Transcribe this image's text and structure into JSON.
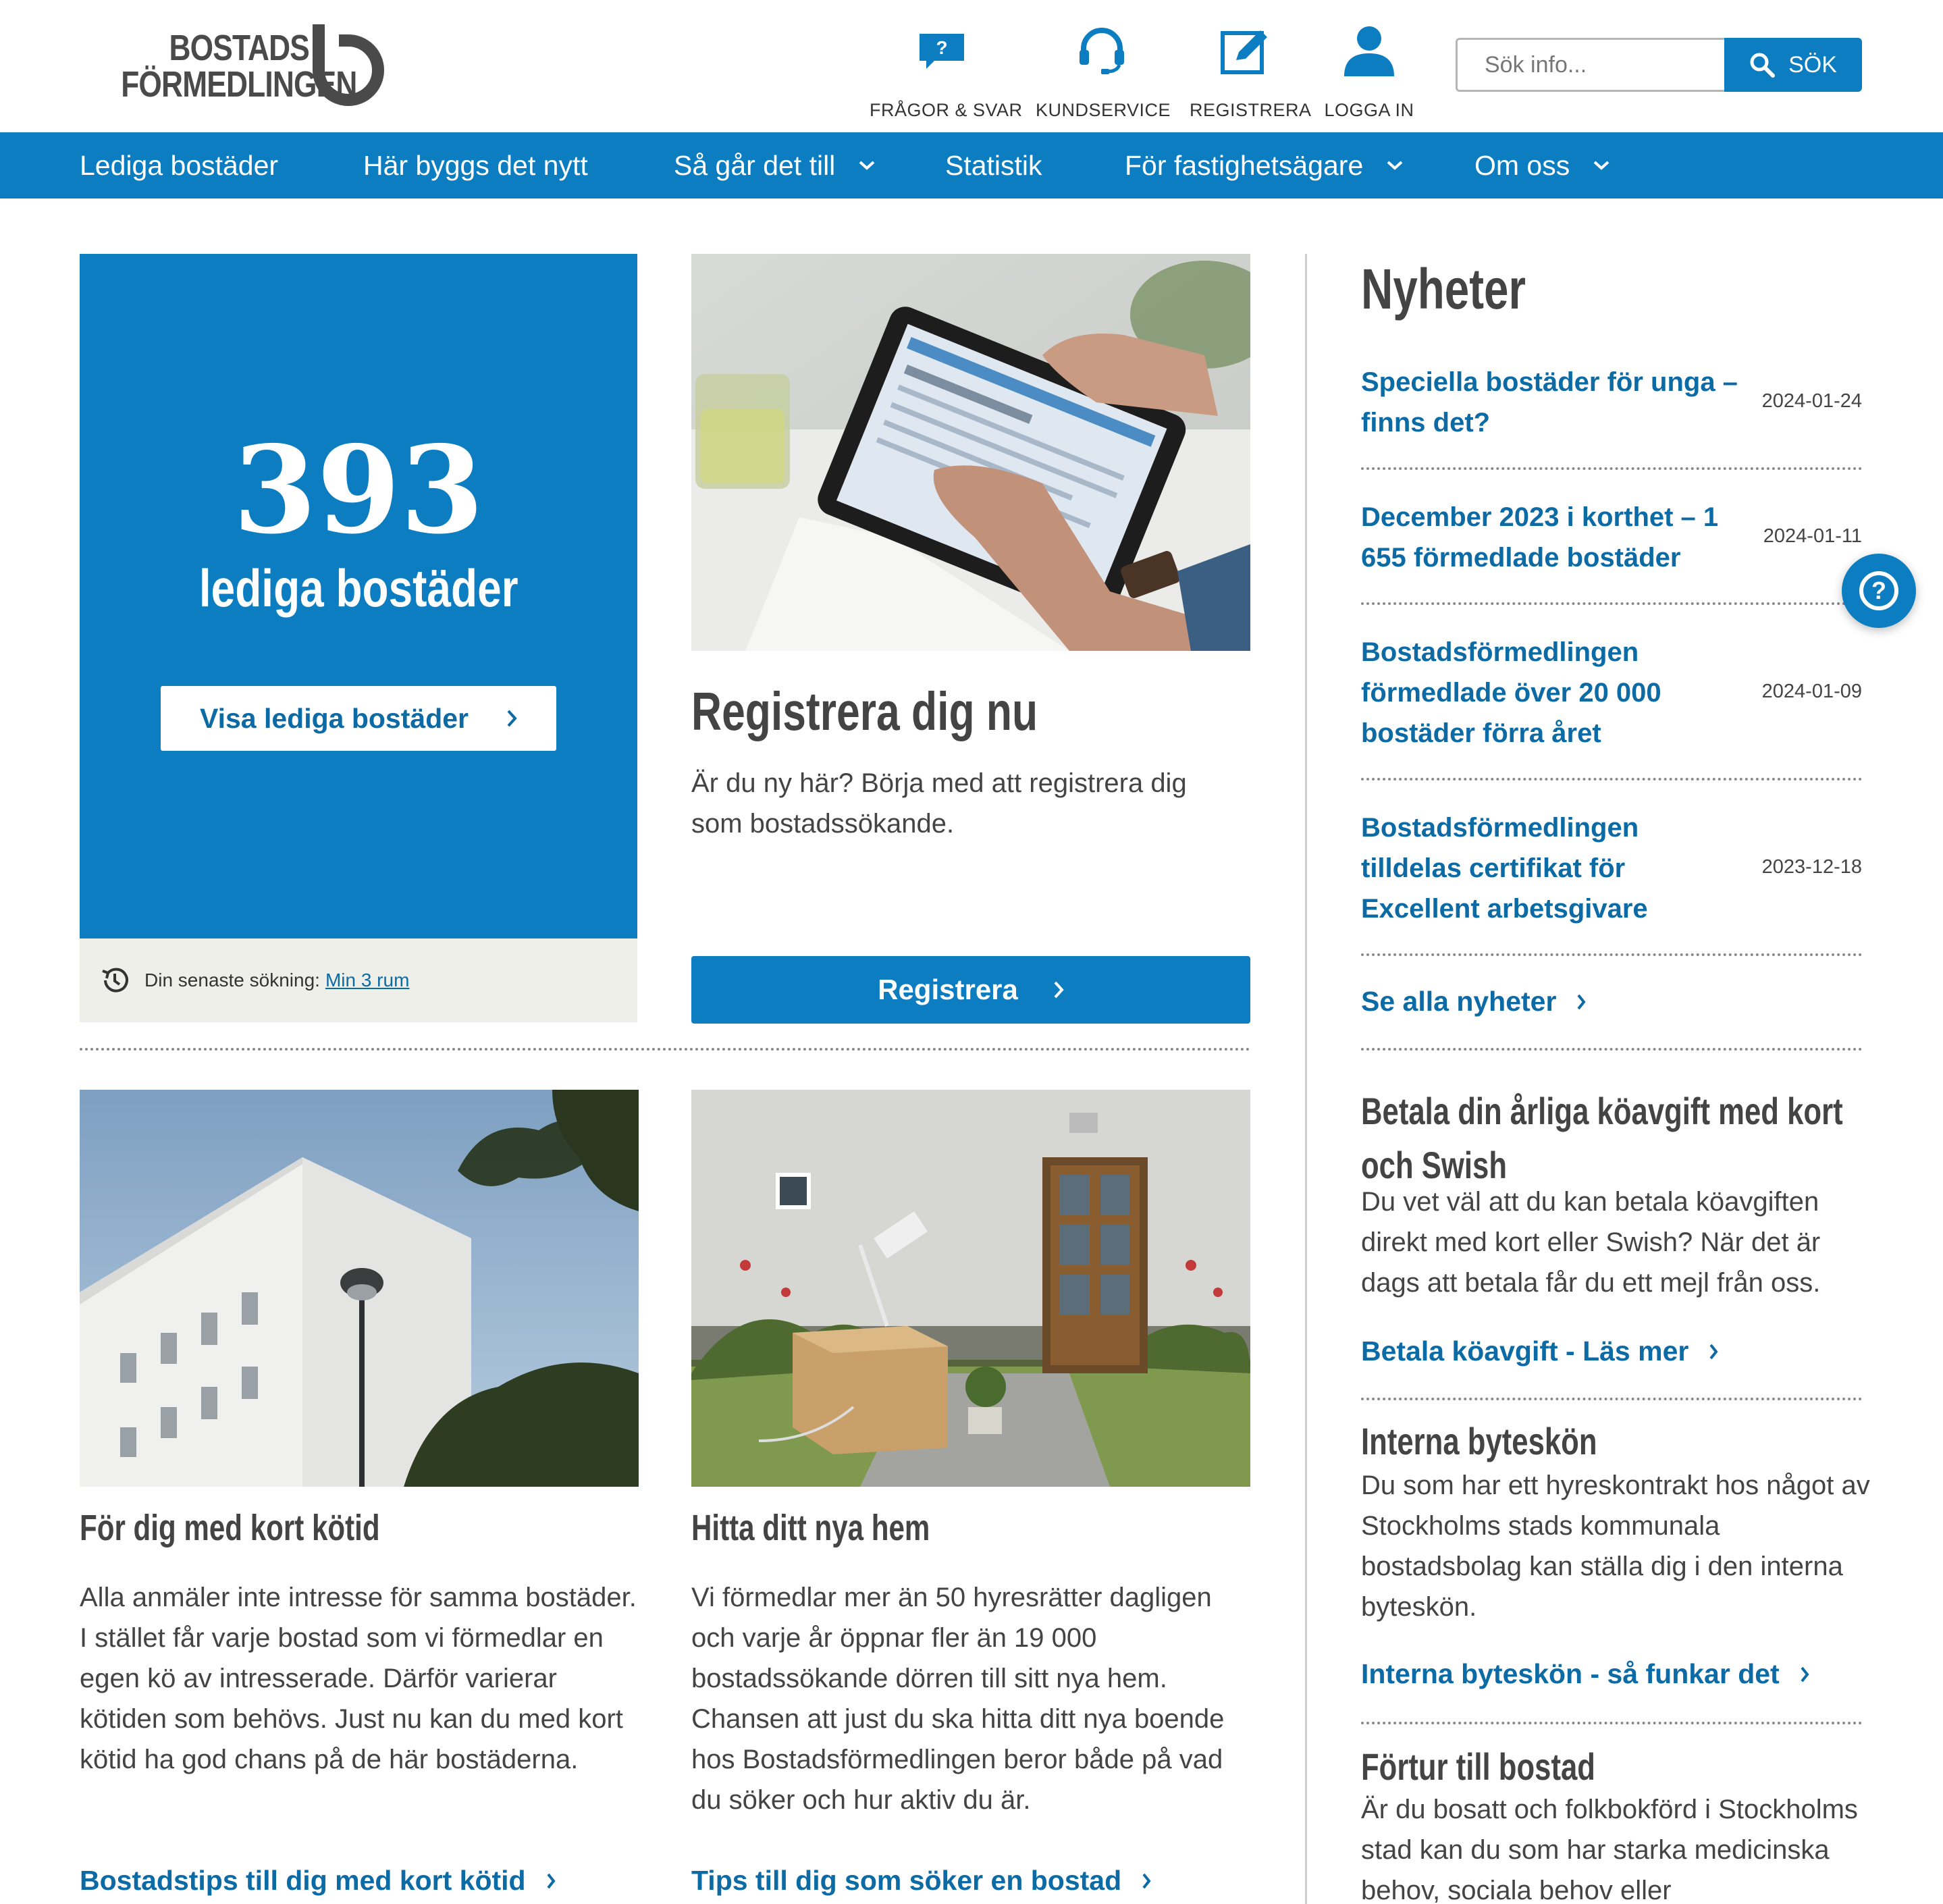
{
  "brand": {
    "logo_line1": "BOSTADS",
    "logo_line2": "FÖRMEDLINGEN",
    "primary_color": "#0c7dc0",
    "link_color": "#0c6aa5"
  },
  "header": {
    "links": [
      {
        "label": "FRÅGOR & SVAR",
        "icon": "question-bubble-icon"
      },
      {
        "label": "KUNDSERVICE",
        "icon": "headset-icon"
      },
      {
        "label": "REGISTRERA",
        "icon": "edit-pencil-icon"
      },
      {
        "label": "LOGGA IN",
        "icon": "user-icon"
      }
    ],
    "search": {
      "placeholder": "Sök info...",
      "button_label": "SÖK",
      "icon": "search-icon"
    }
  },
  "nav": {
    "items": [
      {
        "label": "Lediga bostäder",
        "has_dropdown": false
      },
      {
        "label": "Här byggs det nytt",
        "has_dropdown": false
      },
      {
        "label": "Så går det till",
        "has_dropdown": true
      },
      {
        "label": "Statistik",
        "has_dropdown": false
      },
      {
        "label": "För fastighetsägare",
        "has_dropdown": true
      },
      {
        "label": "Om oss",
        "has_dropdown": true
      }
    ]
  },
  "hero": {
    "count": "393",
    "count_label": "lediga bostäder",
    "button_label": "Visa lediga bostäder",
    "last_search_label": "Din senaste sökning:",
    "last_search_link": "Min 3 rum"
  },
  "register": {
    "title": "Registrera dig nu",
    "text": "Är du ny här? Börja med att registrera dig som bostadssökande.",
    "button_label": "Registrera"
  },
  "cards": [
    {
      "title": "För dig med kort kötid",
      "text": "Alla anmäler inte intresse för samma bostäder. I stället får varje bostad som vi förmedlar en egen kö av intresserade. Därför varierar kötiden som behövs. Just nu kan du med kort kötid ha god chans på de här bostäderna.",
      "link": "Bostadstips till dig med kort kötid"
    },
    {
      "title": "Hitta ditt nya hem",
      "text": "Vi förmedlar mer än 50 hyresrätter dagligen och varje år öppnar fler än 19 000 bostadssökande dörren till sitt nya hem. Chansen att just du ska hitta ditt nya boende hos Bostadsförmedlingen beror både på vad du söker och hur aktiv du är.",
      "link": "Tips till dig som söker en bostad"
    }
  ],
  "sidebar": {
    "news_heading": "Nyheter",
    "news": [
      {
        "title": "Speciella bostäder för unga – finns det?",
        "date": "2024-01-24"
      },
      {
        "title": "December 2023 i korthet – 1 655 förmedlade bostäder",
        "date": "2024-01-11"
      },
      {
        "title": "Bostadsförmedlingen förmedlade över 20 000 bostäder förra året",
        "date": "2024-01-09"
      },
      {
        "title": "Bostadsförmedlingen tilldelas certifikat för Excellent arbetsgivare",
        "date": "2023-12-18"
      }
    ],
    "all_news_link": "Se alla nyheter",
    "blocks": [
      {
        "title": "Betala din årliga köavgift med kort och Swish",
        "text": "Du vet väl att du kan betala köavgiften direkt med kort eller Swish? När det är dags att betala får du ett mejl från oss.",
        "link": "Betala köavgift - Läs mer"
      },
      {
        "title": "Interna byteskön",
        "text": "Du som har ett hyreskontrakt hos något av Stockholms stads kommunala bostadsbolag kan ställa dig i den interna byteskön.",
        "link": "Interna byteskön - så funkar det"
      },
      {
        "title": "Förtur till bostad",
        "text": "Är du bosatt och folkbokförd i Stockholms stad kan du som har starka medicinska behov, sociala behov eller"
      }
    ]
  },
  "help_button": {
    "icon": "help-question-icon"
  }
}
